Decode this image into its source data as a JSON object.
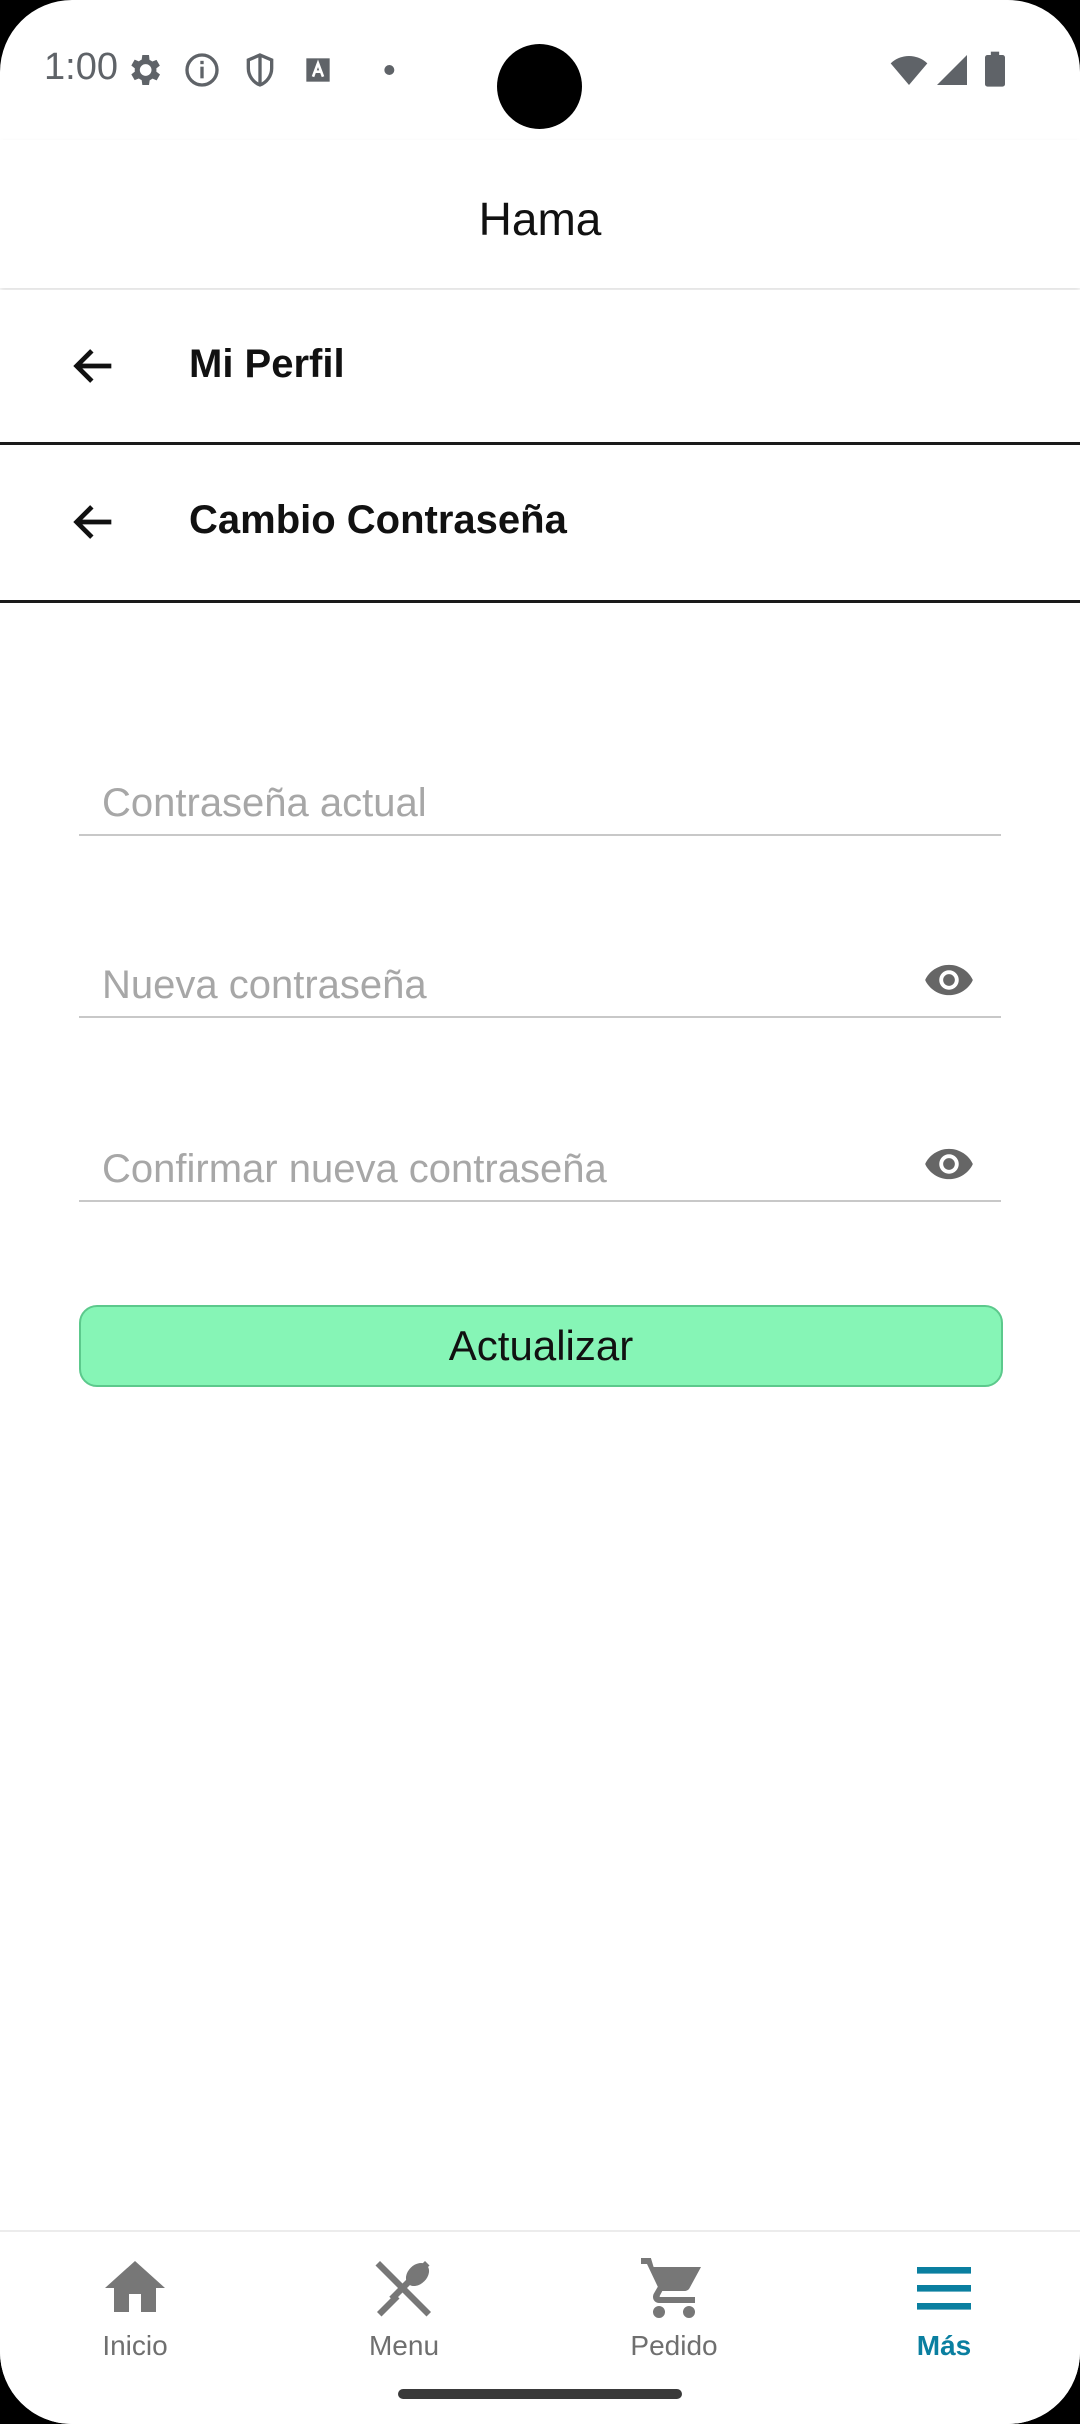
{
  "status_bar": {
    "time": "1:00"
  },
  "app_bar": {
    "title": "Hama"
  },
  "breadcrumbs": [
    {
      "label": "Mi Perfil"
    },
    {
      "label": "Cambio Contraseña"
    }
  ],
  "form": {
    "current_password": {
      "placeholder": "Contraseña actual",
      "value": ""
    },
    "new_password": {
      "placeholder": "Nueva contraseña",
      "value": ""
    },
    "confirm_password": {
      "placeholder": "Confirmar nueva contraseña",
      "value": ""
    },
    "submit_label": "Actualizar"
  },
  "bottom_nav": {
    "items": [
      {
        "label": "Inicio",
        "icon": "home-icon"
      },
      {
        "label": "Menu",
        "icon": "utensils-icon"
      },
      {
        "label": "Pedido",
        "icon": "cart-icon"
      },
      {
        "label": "Más",
        "icon": "menu-icon",
        "active": true
      }
    ]
  },
  "colors": {
    "accent": "#0a7fa0",
    "button": "#86f5b6"
  }
}
